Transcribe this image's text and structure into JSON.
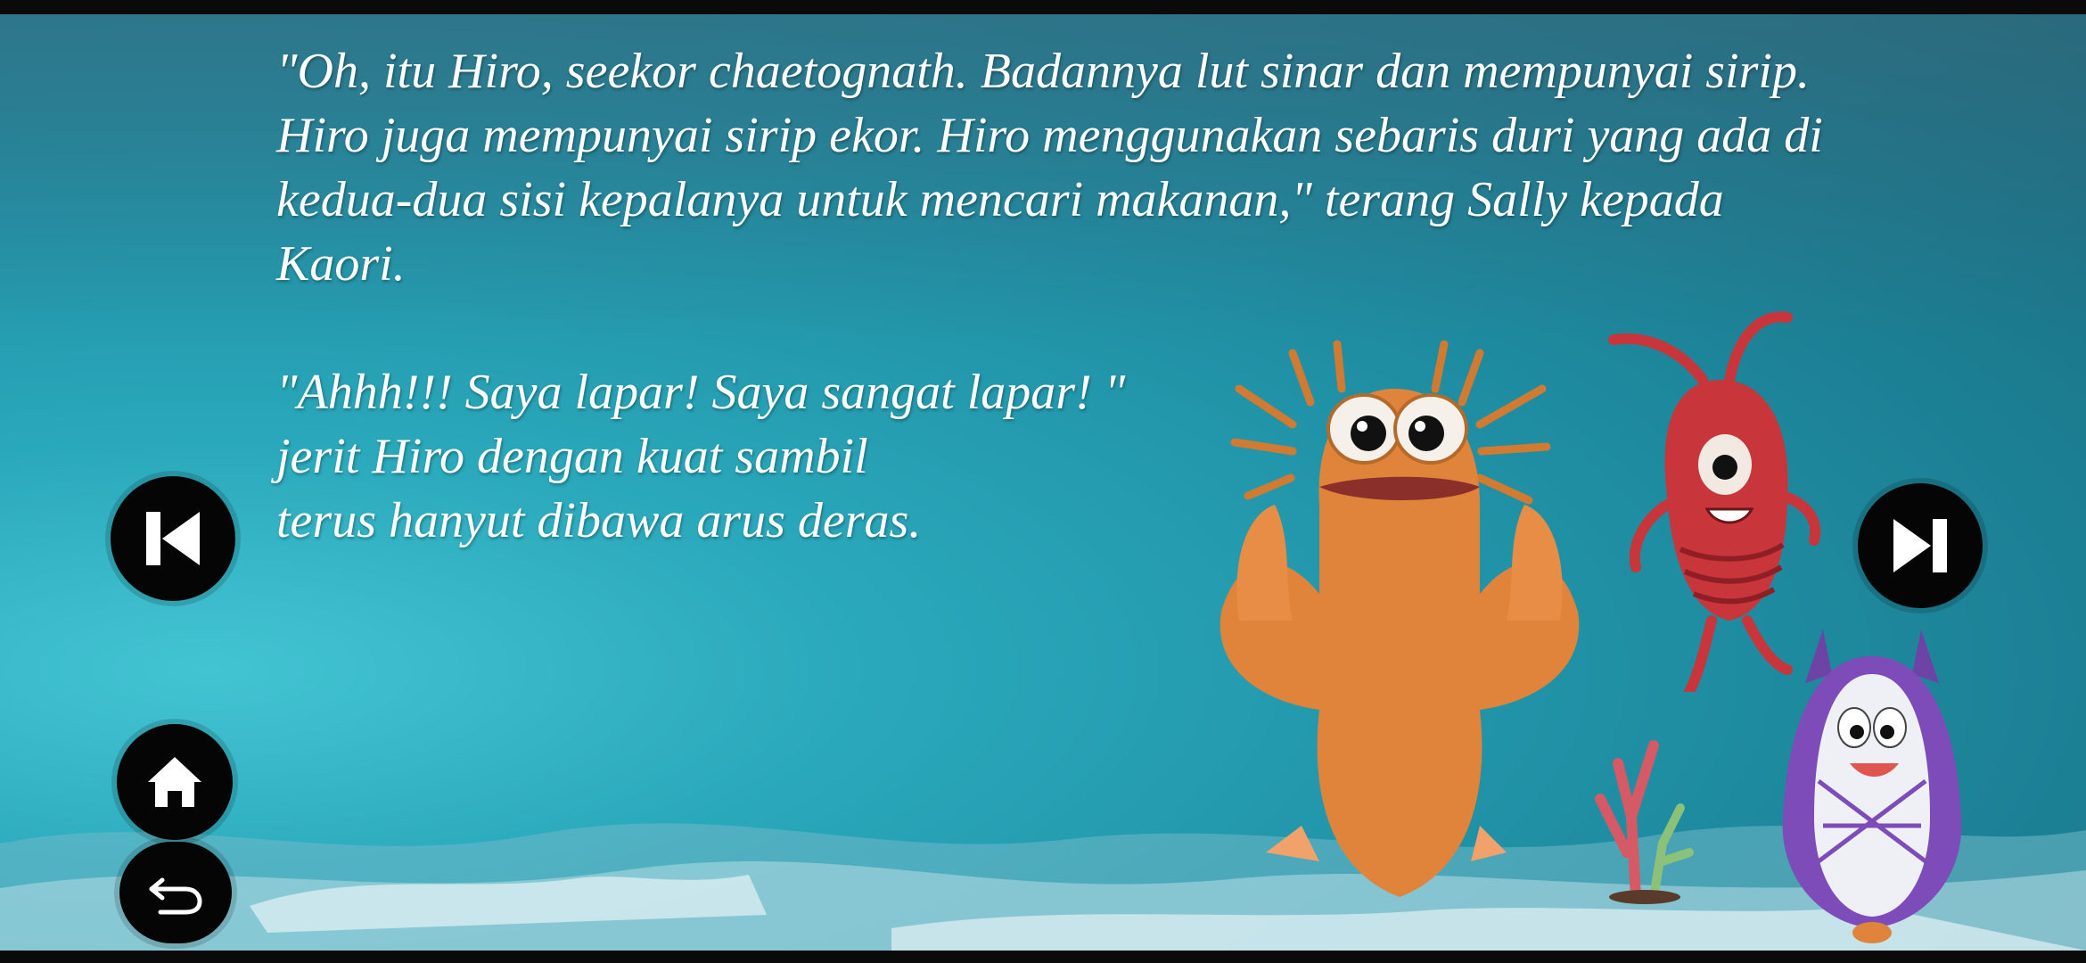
{
  "story": {
    "paragraph1": "\"Oh, itu Hiro, seekor chaetognath. Badannya lut sinar dan mempunyai sirip. Hiro juga mempunyai sirip ekor. Hiro menggunakan sebaris duri yang ada di kedua-dua sisi kepalanya untuk mencari makanan,\" terang Sally kepada Kaori.",
    "paragraph2_lines": [
      "\"Ahhh!!! Saya lapar! Saya sangat lapar! \"",
      "jerit Hiro dengan kuat sambil",
      "terus hanyut dibawa arus deras."
    ]
  },
  "controls": {
    "previous_icon": "skip-previous-icon",
    "next_icon": "skip-next-icon",
    "home_icon": "home-icon",
    "back_icon": "undo-arrow-icon"
  },
  "colors": {
    "water": "#2aa8bb",
    "text": "#ffffff",
    "button": "#050505",
    "hiro_orange": "#e0843c",
    "red_character": "#c8353b",
    "purple_character": "#7d4cb8"
  }
}
